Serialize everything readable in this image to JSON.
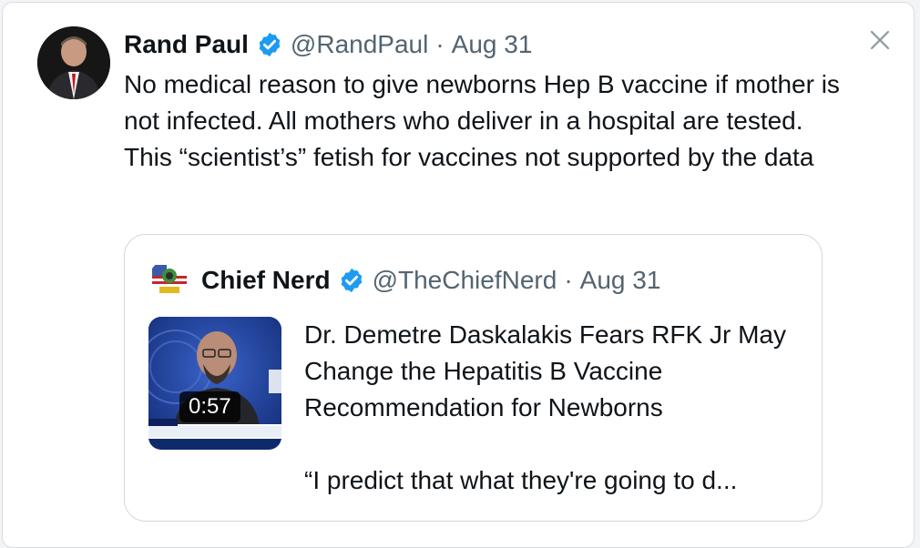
{
  "tweet": {
    "author_name": "Rand Paul",
    "handle": "@RandPaul",
    "separator": "·",
    "date": "Aug 31",
    "text": "No medical reason to give newborns Hep B vaccine if mother is not infected. All mothers who deliver in a hospital are tested. This “scientist’s” fetish for vaccines not supported by the data"
  },
  "quote": {
    "author_name": "Chief Nerd",
    "handle": "@TheChiefNerd",
    "separator": "·",
    "date": "Aug 31",
    "video_duration": "0:57",
    "headline": "Dr. Demetre Daskalakis Fears RFK Jr May Change the Hepatitis B Vaccine Recommendation for Newborns",
    "snippet": "“I predict that what they're going to d..."
  },
  "icons": {
    "verified": "verified-badge-icon",
    "close": "close-icon"
  },
  "colors": {
    "verified_blue": "#1d9bf0",
    "secondary_text": "#536471",
    "border": "#cfd9de"
  }
}
